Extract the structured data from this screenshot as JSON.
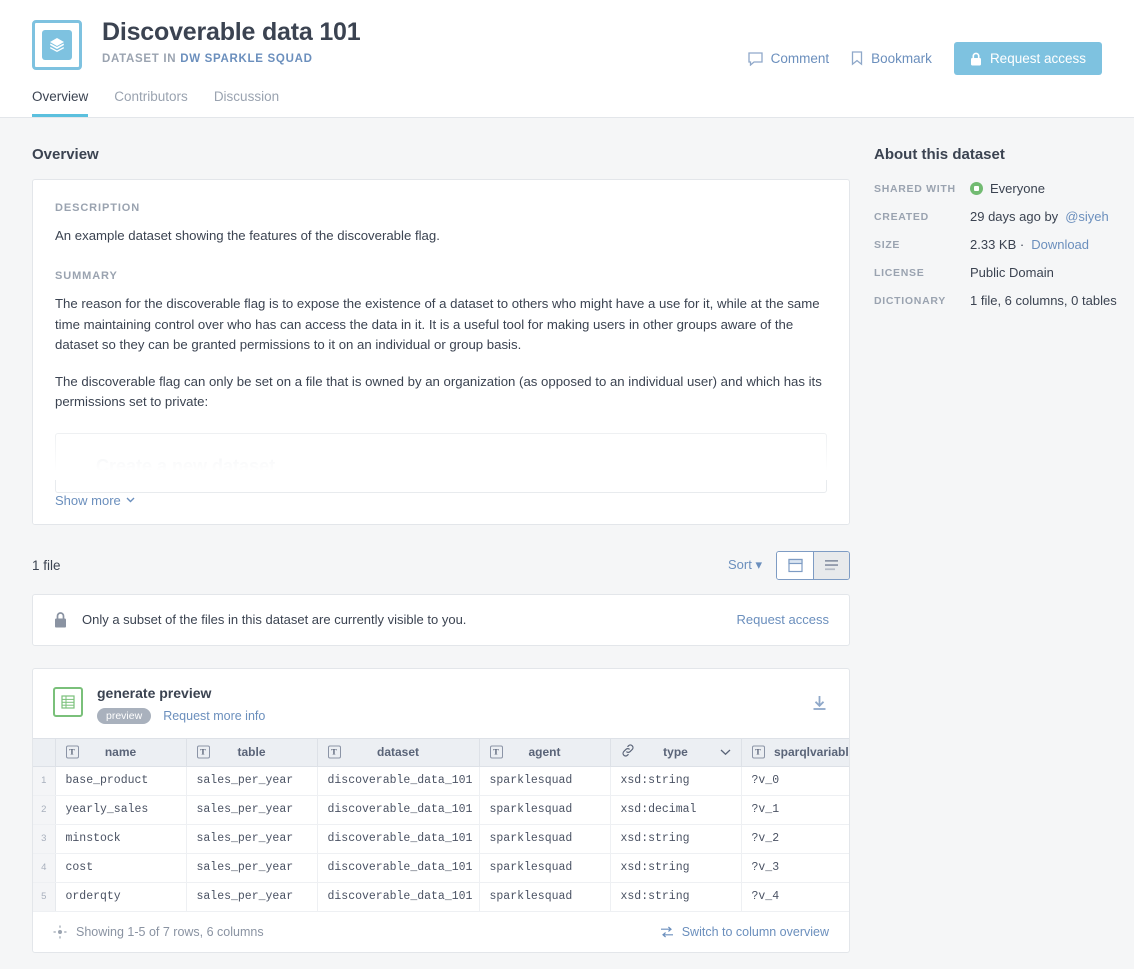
{
  "header": {
    "icon": "dataset-layers-icon",
    "title": "Discoverable data 101",
    "subtitle_prefix": "DATASET IN",
    "subtitle_org": "DW SPARKLE SQUAD",
    "comment_label": "Comment",
    "bookmark_label": "Bookmark",
    "request_access_label": "Request access",
    "accent_color": "#7ec2e0",
    "link_color": "#6b8fbd"
  },
  "tabs": [
    {
      "label": "Overview",
      "active": true
    },
    {
      "label": "Contributors",
      "active": false
    },
    {
      "label": "Discussion",
      "active": false
    }
  ],
  "overview": {
    "section_title": "Overview",
    "description_label": "DESCRIPTION",
    "description_text": "An example dataset showing the features of the discoverable flag.",
    "summary_label": "SUMMARY",
    "summary_paragraphs": [
      "The reason for the discoverable flag is to expose the existence of a dataset to others who might have a use for it, while at the same time maintaining control over who has can access the data in it. It is a useful tool for making users in other groups aware of the dataset so they can be granted permissions to it on an individual or group basis.",
      "The discoverable flag can only be set on a file that is owned by an organization (as opposed to an individual user) and which has its permissions set to private:"
    ],
    "embedded_faded_text": "Create a new dataset",
    "show_more_label": "Show more"
  },
  "files": {
    "count_label": "1 file",
    "sort_label": "Sort",
    "view_card_icon": "card-view-icon",
    "view_list_icon": "list-view-icon",
    "banner": {
      "icon": "lock-icon",
      "text": "Only a subset of the files in this dataset are currently visible to you.",
      "action_label": "Request access"
    }
  },
  "file_preview": {
    "icon": "spreadsheet-icon",
    "name": "generate preview",
    "badge": "preview",
    "more_info_label": "Request more info",
    "download_icon": "download-icon",
    "columns": [
      {
        "label": "name",
        "type_icon": "text-type-icon",
        "has_chevron": false
      },
      {
        "label": "table",
        "type_icon": "text-type-icon",
        "has_chevron": false
      },
      {
        "label": "dataset",
        "type_icon": "text-type-icon",
        "has_chevron": false
      },
      {
        "label": "agent",
        "type_icon": "text-type-icon",
        "has_chevron": false
      },
      {
        "label": "type",
        "type_icon": "link-type-icon",
        "has_chevron": true
      },
      {
        "label": "sparqlvariablenam",
        "type_icon": "text-type-icon",
        "has_chevron": false
      }
    ],
    "rows": [
      {
        "n": "1",
        "name": "base_product",
        "table": "sales_per_year",
        "dataset": "discoverable_data_101",
        "agent": "sparklesquad",
        "type": "xsd:string",
        "sparqlvariablename": "?v_0"
      },
      {
        "n": "2",
        "name": "yearly_sales",
        "table": "sales_per_year",
        "dataset": "discoverable_data_101",
        "agent": "sparklesquad",
        "type": "xsd:decimal",
        "sparqlvariablename": "?v_1"
      },
      {
        "n": "3",
        "name": "minstock",
        "table": "sales_per_year",
        "dataset": "discoverable_data_101",
        "agent": "sparklesquad",
        "type": "xsd:string",
        "sparqlvariablename": "?v_2"
      },
      {
        "n": "4",
        "name": "cost",
        "table": "sales_per_year",
        "dataset": "discoverable_data_101",
        "agent": "sparklesquad",
        "type": "xsd:string",
        "sparqlvariablename": "?v_3"
      },
      {
        "n": "5",
        "name": "orderqty",
        "table": "sales_per_year",
        "dataset": "discoverable_data_101",
        "agent": "sparklesquad",
        "type": "xsd:string",
        "sparqlvariablename": "?v_4"
      }
    ],
    "footer_status": "Showing 1-5 of 7 rows, 6 columns",
    "footer_switch_label": "Switch to column overview"
  },
  "about": {
    "title": "About this dataset",
    "rows": [
      {
        "key": "SHARED WITH",
        "value": "Everyone",
        "badge": "globe-badge"
      },
      {
        "key": "CREATED",
        "value": "29 days ago by ",
        "link": "@siyeh"
      },
      {
        "key": "SIZE",
        "value": "2.33 KB · ",
        "link": "Download"
      },
      {
        "key": "LICENSE",
        "value": "Public Domain"
      },
      {
        "key": "DICTIONARY",
        "value": "1 file, 6 columns, 0 tables"
      }
    ]
  }
}
